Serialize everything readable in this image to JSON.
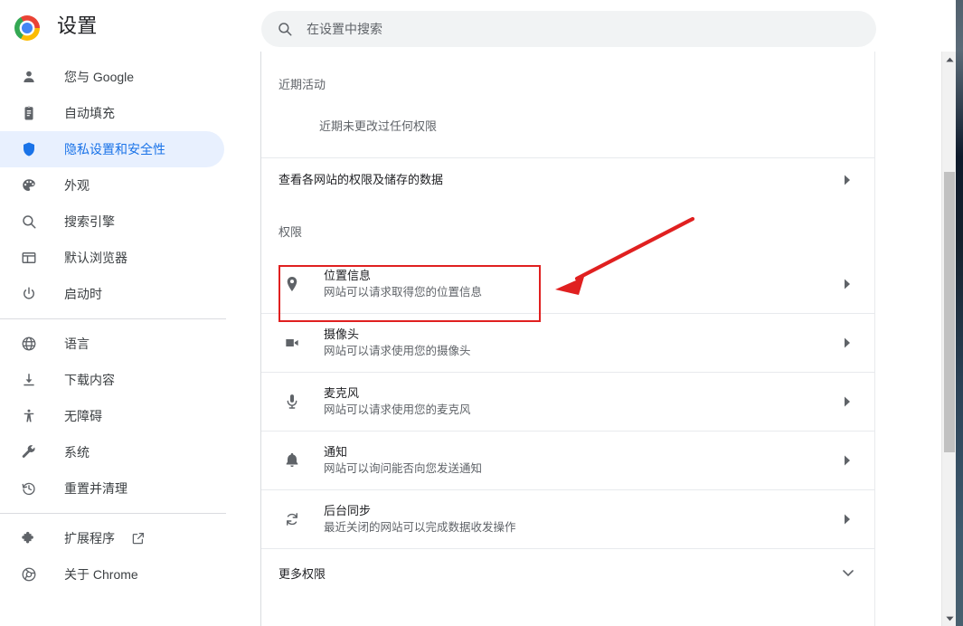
{
  "header": {
    "logo_icon": "chrome-logo-icon",
    "title": "设置",
    "search": {
      "icon": "search-icon",
      "placeholder": "在设置中搜索",
      "value": ""
    }
  },
  "sidebar": {
    "groups": [
      {
        "items": [
          {
            "icon": "person-icon",
            "label": "您与 Google",
            "active": false
          },
          {
            "icon": "autofill-icon",
            "label": "自动填充",
            "active": false
          },
          {
            "icon": "shield-icon",
            "label": "隐私设置和安全性",
            "active": true
          },
          {
            "icon": "palette-icon",
            "label": "外观",
            "active": false
          },
          {
            "icon": "search-icon",
            "label": "搜索引擎",
            "active": false
          },
          {
            "icon": "browser-icon",
            "label": "默认浏览器",
            "active": false
          },
          {
            "icon": "power-icon",
            "label": "启动时",
            "active": false
          }
        ]
      },
      {
        "items": [
          {
            "icon": "globe-icon",
            "label": "语言",
            "active": false
          },
          {
            "icon": "download-icon",
            "label": "下载内容",
            "active": false
          },
          {
            "icon": "accessibility-icon",
            "label": "无障碍",
            "active": false
          },
          {
            "icon": "wrench-icon",
            "label": "系统",
            "active": false
          },
          {
            "icon": "restore-icon",
            "label": "重置并清理",
            "active": false
          }
        ]
      },
      {
        "items": [
          {
            "icon": "puzzle-icon",
            "label": "扩展程序",
            "active": false,
            "external_icon": "external-link-icon"
          },
          {
            "icon": "chrome-icon",
            "label": "关于 Chrome",
            "active": false
          }
        ]
      }
    ]
  },
  "main": {
    "recent_activity": {
      "section_label": "近期活动",
      "empty_message": "近期未更改过任何权限"
    },
    "site_data_row": {
      "label": "查看各网站的权限及储存的数据",
      "chevron_icon": "chevron-right-icon"
    },
    "permissions": {
      "section_label": "权限",
      "rows": [
        {
          "icon": "location-pin-icon",
          "title": "位置信息",
          "subtitle": "网站可以请求取得您的位置信息",
          "chevron_icon": "chevron-right-icon",
          "highlighted": true
        },
        {
          "icon": "camera-icon",
          "title": "摄像头",
          "subtitle": "网站可以请求使用您的摄像头",
          "chevron_icon": "chevron-right-icon",
          "highlighted": false
        },
        {
          "icon": "microphone-icon",
          "title": "麦克风",
          "subtitle": "网站可以请求使用您的麦克风",
          "chevron_icon": "chevron-right-icon",
          "highlighted": false
        },
        {
          "icon": "bell-icon",
          "title": "通知",
          "subtitle": "网站可以询问能否向您发送通知",
          "chevron_icon": "chevron-right-icon",
          "highlighted": false
        },
        {
          "icon": "sync-icon",
          "title": "后台同步",
          "subtitle": "最近关闭的网站可以完成数据收发操作",
          "chevron_icon": "chevron-right-icon",
          "highlighted": false
        }
      ],
      "more_row": {
        "label": "更多权限",
        "chevron_icon": "chevron-down-icon"
      }
    }
  },
  "annotation": {
    "box_target": "位置信息",
    "arrow_icon": "red-arrow-icon",
    "color": "#e02020"
  },
  "scrollbar": {
    "up_icon": "scroll-up-arrow-icon",
    "down_icon": "scroll-down-arrow-icon",
    "thumb_color": "#c1c1c1"
  }
}
